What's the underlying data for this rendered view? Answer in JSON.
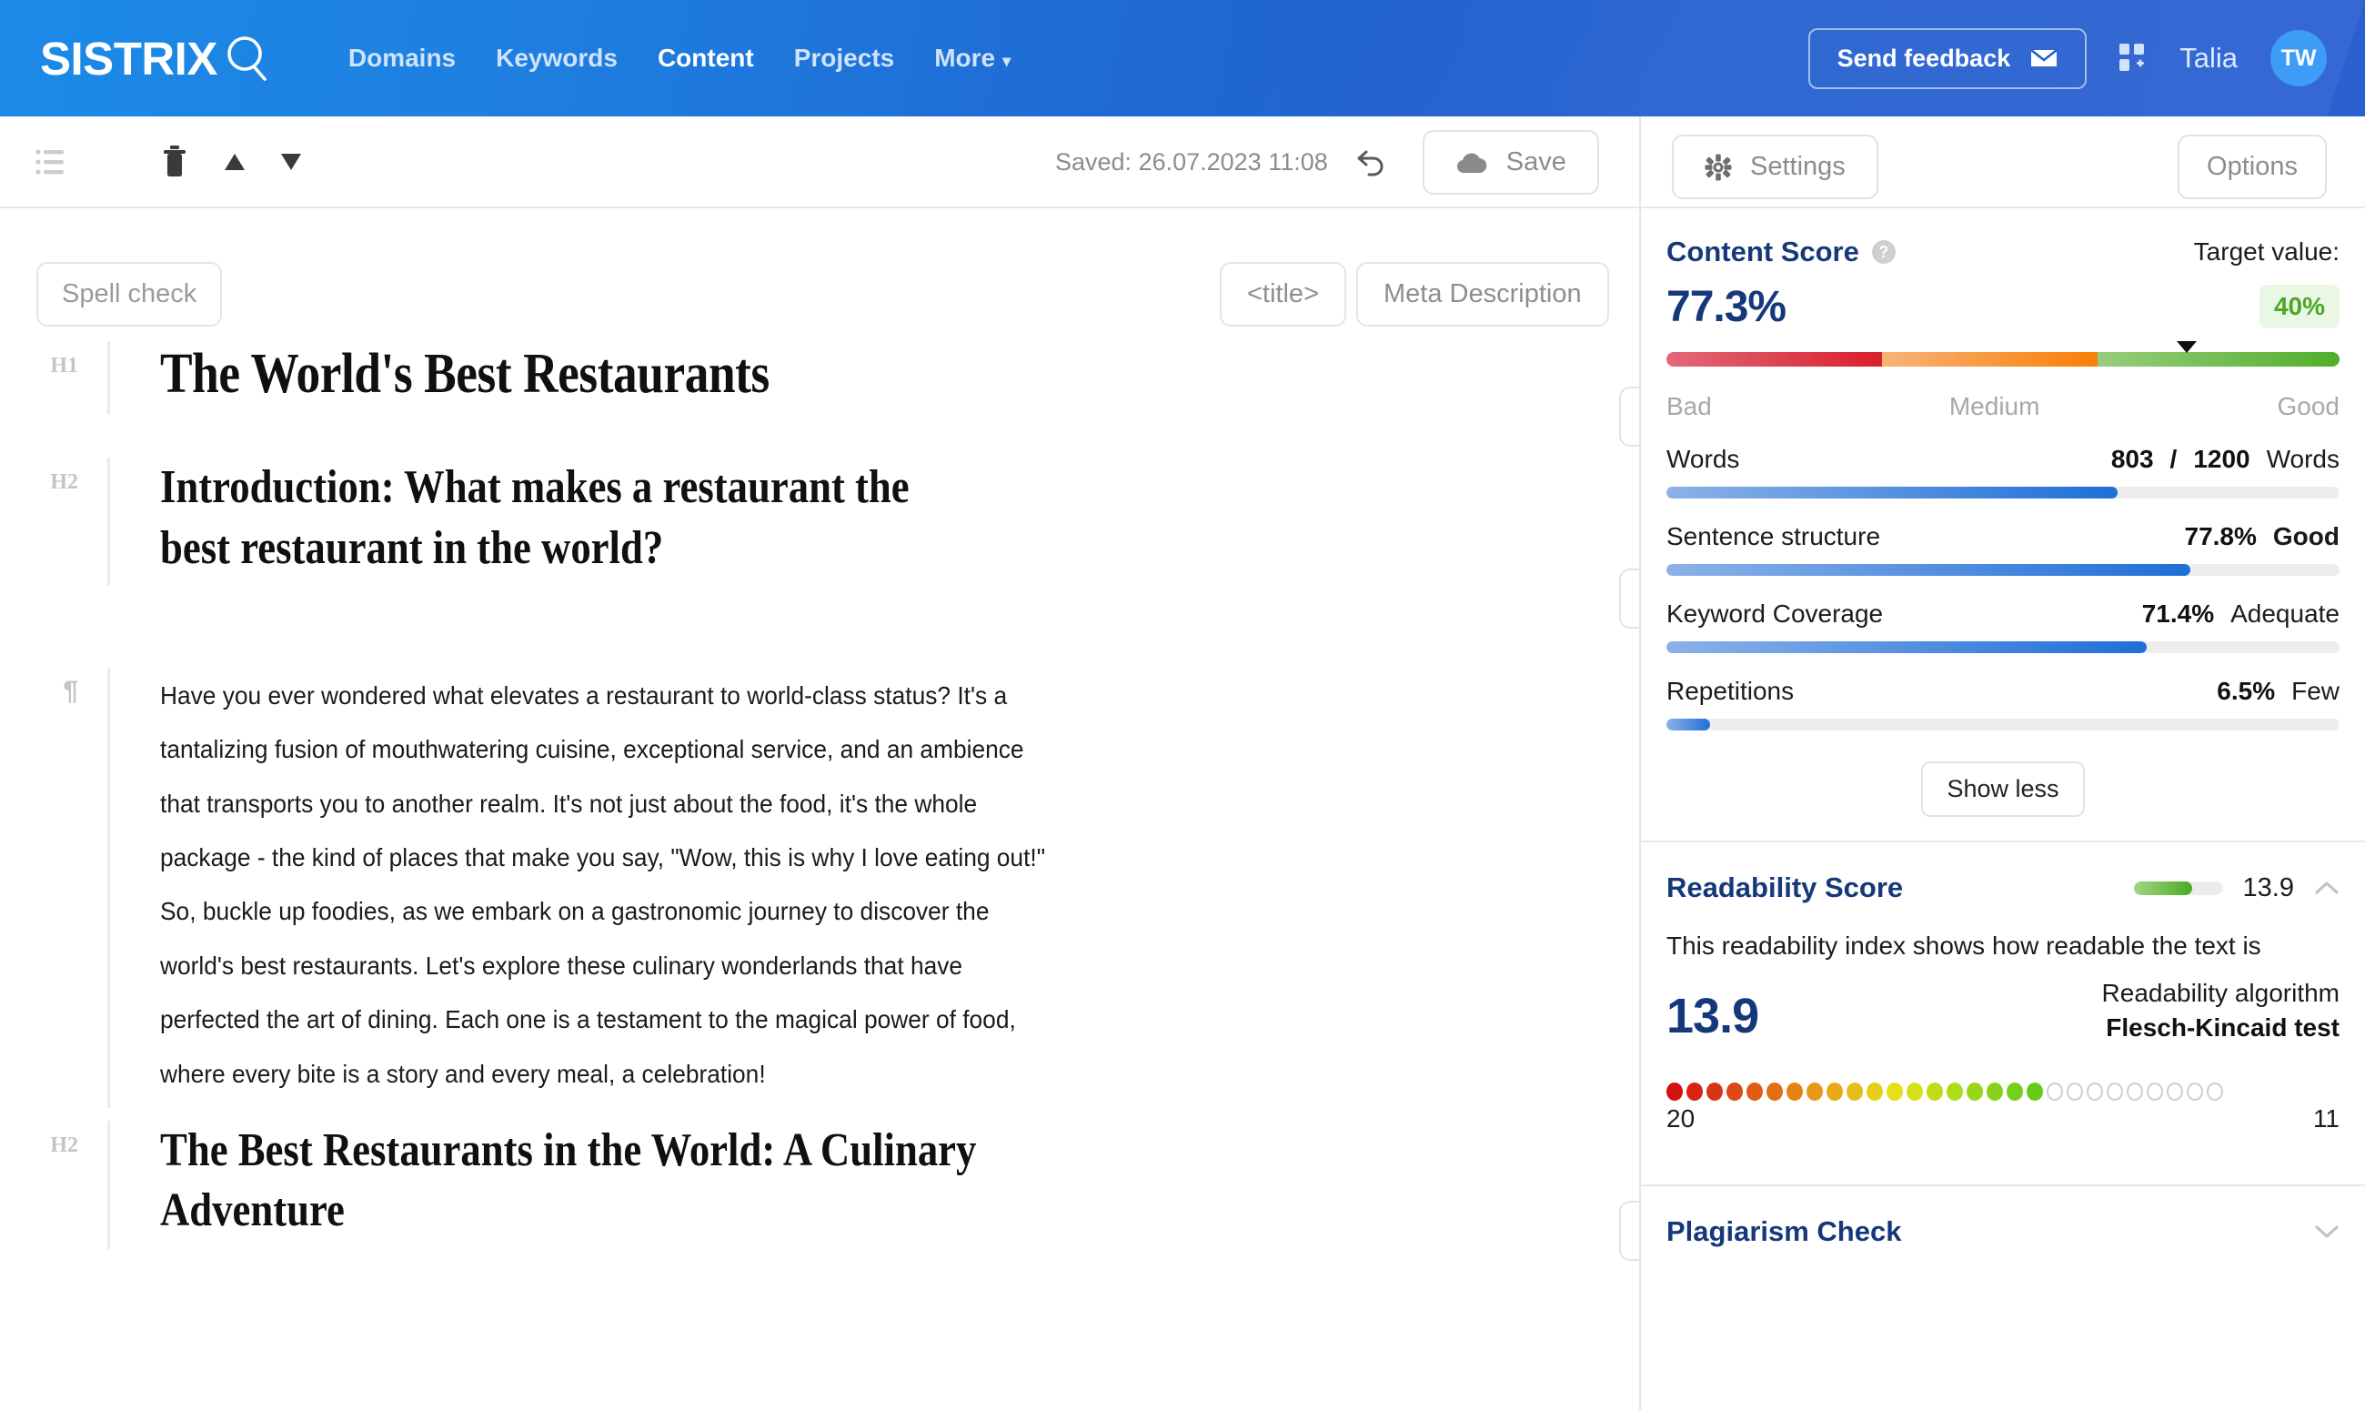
{
  "header": {
    "brand": "SISTRIX",
    "nav": [
      {
        "label": "Domains",
        "active": false
      },
      {
        "label": "Keywords",
        "active": false
      },
      {
        "label": "Content",
        "active": true
      },
      {
        "label": "Projects",
        "active": false
      },
      {
        "label": "More",
        "active": false,
        "caret": "▾"
      }
    ],
    "feedback_label": "Send feedback",
    "username": "Talia",
    "avatar_initials": "TW",
    "accent_color": "#2060cf"
  },
  "toolbar": {
    "saved_text": "Saved: 26.07.2023 11:08",
    "save_label": "Save",
    "settings_label": "Settings",
    "options_label": "Options"
  },
  "editor": {
    "spellcheck_label": "Spell check",
    "title_tag_label": "<title>",
    "meta_description_label": "Meta Description",
    "blocks": [
      {
        "tag": "H1",
        "text": "The World's Best Restaurants"
      },
      {
        "tag": "H2",
        "text": "Introduction: What makes a restaurant the best restaurant in the world?"
      },
      {
        "tag": "¶",
        "text": "Have you ever wondered what elevates a restaurant to world-class status? It's a tantalizing fusion of mouthwatering cuisine, exceptional service, and an ambience that transports you to another realm. It's not just about the food, it's the whole package - the kind of places that make you say, \"Wow, this is why I love eating out!\" So, buckle up foodies, as we embark on a gastronomic journey to discover the world's best restaurants. Let's explore these culinary wonderlands that have perfected the art of dining. Each one is a testament to the magical power of food, where every bite is a story and every meal, a celebration!"
      },
      {
        "tag": "H2",
        "text": "The Best Restaurants in the World: A Culinary Adventure"
      }
    ]
  },
  "sidebar": {
    "content_score": {
      "title": "Content Score",
      "target_label": "Target value:",
      "score": "77.3%",
      "score_pct": 77.3,
      "target_badge": "40%",
      "marker_pct": 77.3,
      "legend": {
        "bad": "Bad",
        "medium": "Medium",
        "good": "Good"
      },
      "metrics": [
        {
          "label": "Words",
          "value": "803",
          "separator": "/",
          "target": "1200",
          "unit": "Words",
          "bold_qual": false,
          "fill_pct": 67
        },
        {
          "label": "Sentence structure",
          "value": "77.8%",
          "qual": "Good",
          "bold_qual": true,
          "fill_pct": 77.8
        },
        {
          "label": "Keyword Coverage",
          "value": "71.4%",
          "qual": "Adequate",
          "bold_qual": false,
          "fill_pct": 71.4
        },
        {
          "label": "Repetitions",
          "value": "6.5%",
          "qual": "Few",
          "bold_qual": false,
          "fill_pct": 6.5
        }
      ],
      "show_less_label": "Show less"
    },
    "readability": {
      "title": "Readability Score",
      "mini_score": "13.9",
      "mini_fill_pct": 66,
      "description": "This readability index shows how readable the text is",
      "big_score": "13.9",
      "algorithm_label": "Readability algorithm",
      "algorithm_name": "Flesch-Kincaid test",
      "scale_left": "20",
      "scale_right": "11",
      "dots_total": 28,
      "dots_filled": 19
    },
    "plagiarism": {
      "title": "Plagiarism Check"
    }
  }
}
